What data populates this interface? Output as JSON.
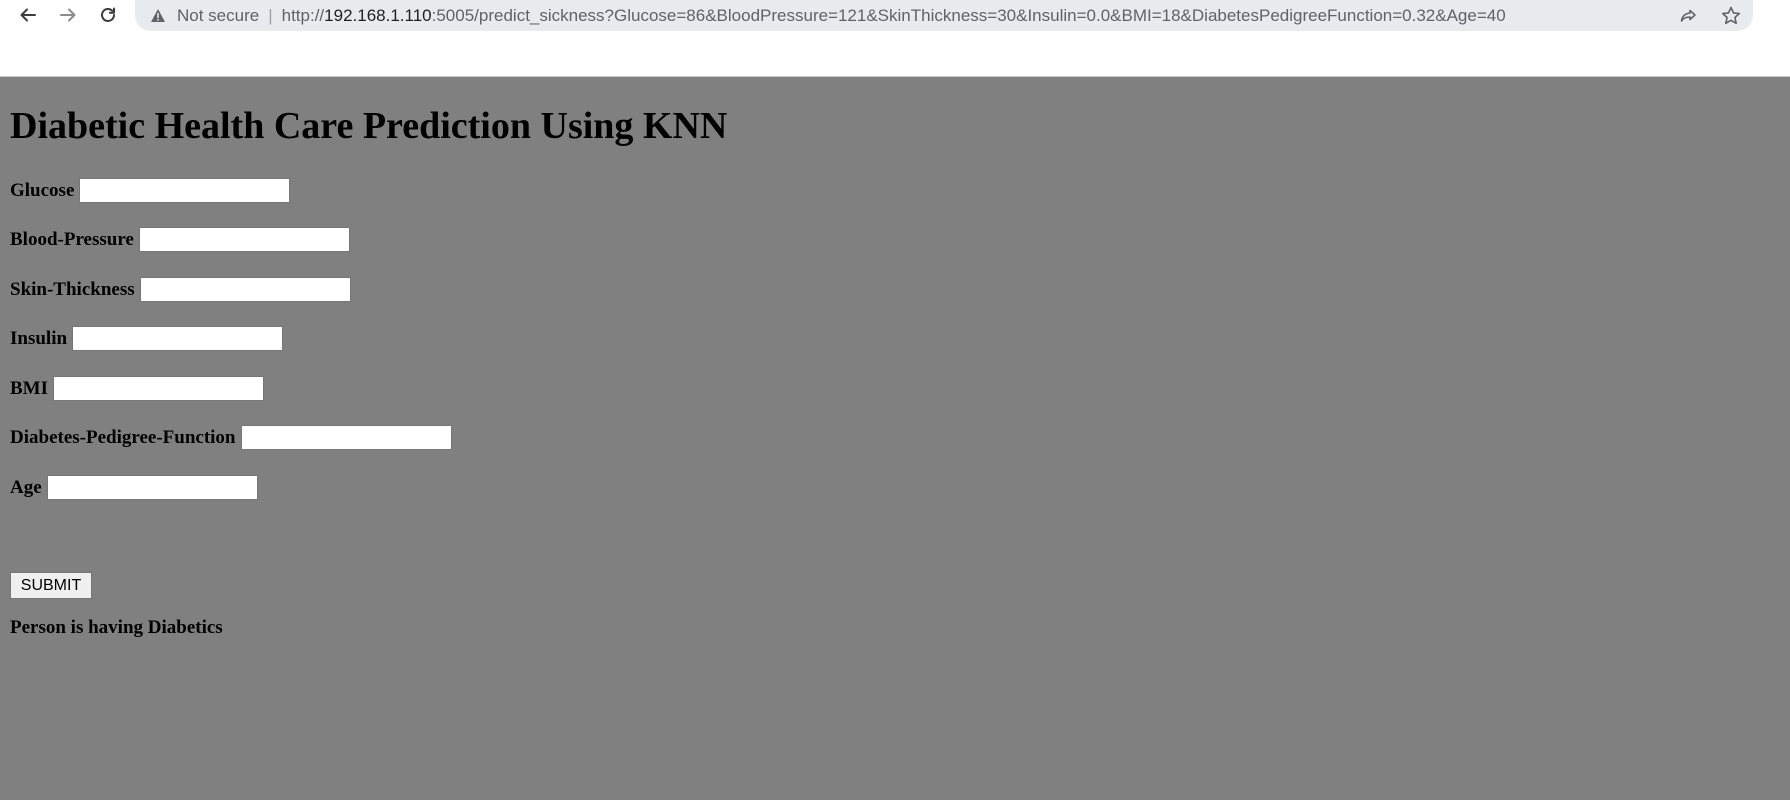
{
  "browser": {
    "security_label": "Not secure",
    "separator": "|",
    "url_prefix": "http://",
    "url_host": "192.168.1.110",
    "url_rest": ":5005/predict_sickness?Glucose=86&BloodPressure=121&SkinThickness=30&Insulin=0.0&BMI=18&DiabetesPedigreeFunction=0.32&Age=40"
  },
  "page": {
    "title": "Diabetic Health Care Prediction Using KNN",
    "fields": [
      {
        "label": "Glucose",
        "value": "",
        "placeholder": ""
      },
      {
        "label": "Blood-Pressure",
        "value": "",
        "placeholder": ""
      },
      {
        "label": "Skin-Thickness",
        "value": "",
        "placeholder": ""
      },
      {
        "label": "Insulin",
        "value": "",
        "placeholder": ""
      },
      {
        "label": "BMI",
        "value": "",
        "placeholder": ""
      },
      {
        "label": "Diabetes-Pedigree-Function",
        "value": "",
        "placeholder": ""
      },
      {
        "label": "Age",
        "value": "",
        "placeholder": ""
      }
    ],
    "submit_label": "SUBMIT",
    "result": "Person is having Diabetics"
  },
  "icons": {
    "back": "arrow-left-icon",
    "forward": "arrow-right-icon",
    "reload": "reload-icon",
    "warning": "warning-triangle-icon",
    "share": "share-icon",
    "bookmark": "star-icon"
  },
  "colors": {
    "page_background": "#808080",
    "omnibox_background": "#e8eaed"
  }
}
